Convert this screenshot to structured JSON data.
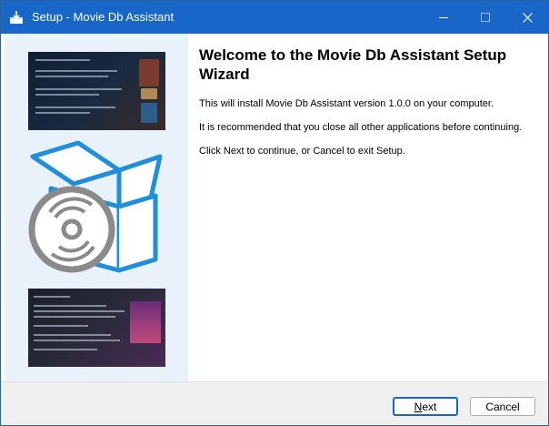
{
  "window": {
    "title": "Setup - Movie Db Assistant",
    "accent_color": "#1766c8"
  },
  "titlebar": {
    "icons": [
      "installer-icon",
      "minimize-icon",
      "maximize-icon",
      "close-icon"
    ]
  },
  "main": {
    "heading": "Welcome to the Movie Db Assistant Setup Wizard",
    "paragraphs": [
      "This will install Movie Db Assistant version 1.0.0 on your computer.",
      "It is recommended that you close all other applications before continuing.",
      "Click Next to continue, or Cancel to exit Setup."
    ]
  },
  "sidebar": {
    "images": [
      "app-screenshot-top",
      "software-box-with-disc",
      "app-screenshot-bottom"
    ]
  },
  "footer": {
    "next_label_accel": "N",
    "next_label_rest": "ext",
    "cancel_label": "Cancel"
  }
}
